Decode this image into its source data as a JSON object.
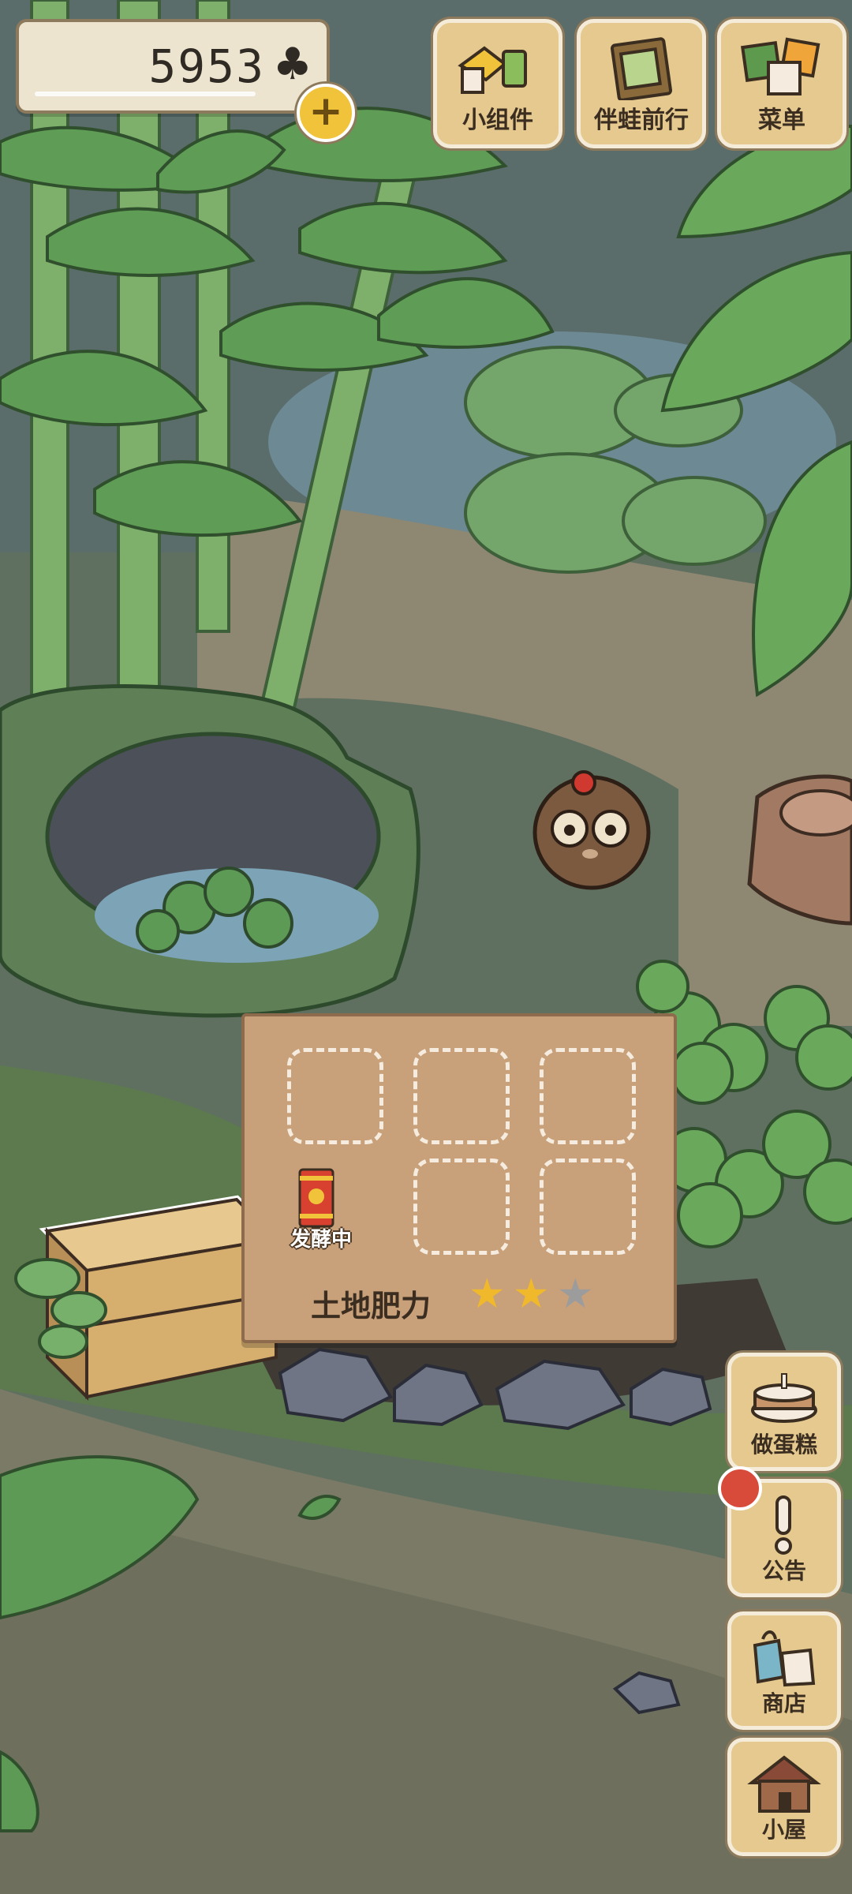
{
  "hud": {
    "clover_count": "5953",
    "clover_icon": "clover-icon",
    "add_button_icon": "plus-icon"
  },
  "top_menu": [
    {
      "label": "小组件",
      "icon": "widget-icon"
    },
    {
      "label": "伴蛙前行",
      "icon": "journal-icon"
    },
    {
      "label": "菜单",
      "icon": "menu-icon"
    }
  ],
  "garden_board": {
    "fermenting_label": "发酵中",
    "fermenting_item_icon": "fermentation-can-icon",
    "fertility_label": "土地肥力",
    "fertility_stars_filled": 2,
    "fertility_stars_total": 3,
    "empty_slots": 5
  },
  "side_menu": [
    {
      "label": "做蛋糕",
      "icon": "cake-icon"
    },
    {
      "label": "公告",
      "icon": "exclamation-icon",
      "has_notification": true
    },
    {
      "label": "商店",
      "icon": "shop-bags-icon"
    },
    {
      "label": "小屋",
      "icon": "house-icon"
    }
  ],
  "colors": {
    "button_wood": "#e5c98f",
    "board_wood": "#c8a07a",
    "star_filled": "#f0b92c",
    "star_empty": "#9c9c9c",
    "notification_red": "#d84a3a"
  }
}
